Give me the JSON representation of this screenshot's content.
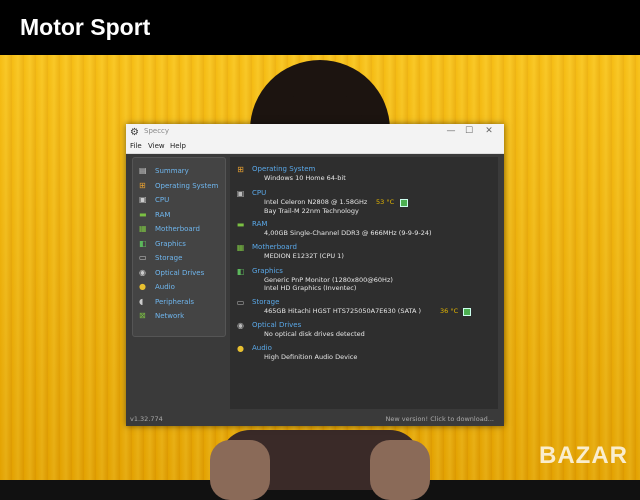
{
  "header": {
    "title": "Motor Sport"
  },
  "watermark": {
    "text": "BAZAR"
  },
  "window": {
    "title": "Speccy",
    "controls": {
      "minimize": "—",
      "maximize": "☐",
      "close": "✕"
    },
    "menu": [
      "File",
      "View",
      "Help"
    ]
  },
  "sidebar": {
    "items": [
      {
        "label": "Summary",
        "icon": "summary-icon"
      },
      {
        "label": "Operating System",
        "icon": "windows-icon"
      },
      {
        "label": "CPU",
        "icon": "cpu-icon"
      },
      {
        "label": "RAM",
        "icon": "ram-icon"
      },
      {
        "label": "Motherboard",
        "icon": "motherboard-icon"
      },
      {
        "label": "Graphics",
        "icon": "graphics-icon"
      },
      {
        "label": "Storage",
        "icon": "storage-icon"
      },
      {
        "label": "Optical Drives",
        "icon": "optical-icon"
      },
      {
        "label": "Audio",
        "icon": "audio-icon"
      },
      {
        "label": "Peripherals",
        "icon": "peripherals-icon"
      },
      {
        "label": "Network",
        "icon": "network-icon"
      }
    ]
  },
  "summary": {
    "os": {
      "title": "Operating System",
      "lines": [
        "Windows 10 Home 64-bit"
      ]
    },
    "cpu": {
      "title": "CPU",
      "lines": [
        "Intel Celeron N2808 @ 1.58GHz",
        "Bay Trail-M 22nm Technology"
      ],
      "temp": "53 °C"
    },
    "ram": {
      "title": "RAM",
      "lines": [
        "4,00GB Single-Channel DDR3 @ 666MHz (9-9-9-24)"
      ]
    },
    "motherboard": {
      "title": "Motherboard",
      "lines": [
        "MEDION E1232T (CPU 1)"
      ]
    },
    "graphics": {
      "title": "Graphics",
      "lines": [
        "Generic PnP Monitor (1280x800@60Hz)",
        "Intel HD Graphics (Inventec)"
      ]
    },
    "storage": {
      "title": "Storage",
      "lines": [
        "465GB Hitachi HGST HTS725050A7E630 (SATA )"
      ],
      "temp": "36 °C"
    },
    "optical": {
      "title": "Optical Drives",
      "lines": [
        "No optical disk drives detected"
      ]
    },
    "audio": {
      "title": "Audio",
      "lines": [
        "High Definition Audio Device"
      ]
    }
  },
  "status": {
    "version": "v1.32.774",
    "update": "New version! Click to download..."
  },
  "colors": {
    "accent": "#5aa8e8",
    "temp": "#e6b800",
    "background": "#f2b200"
  }
}
